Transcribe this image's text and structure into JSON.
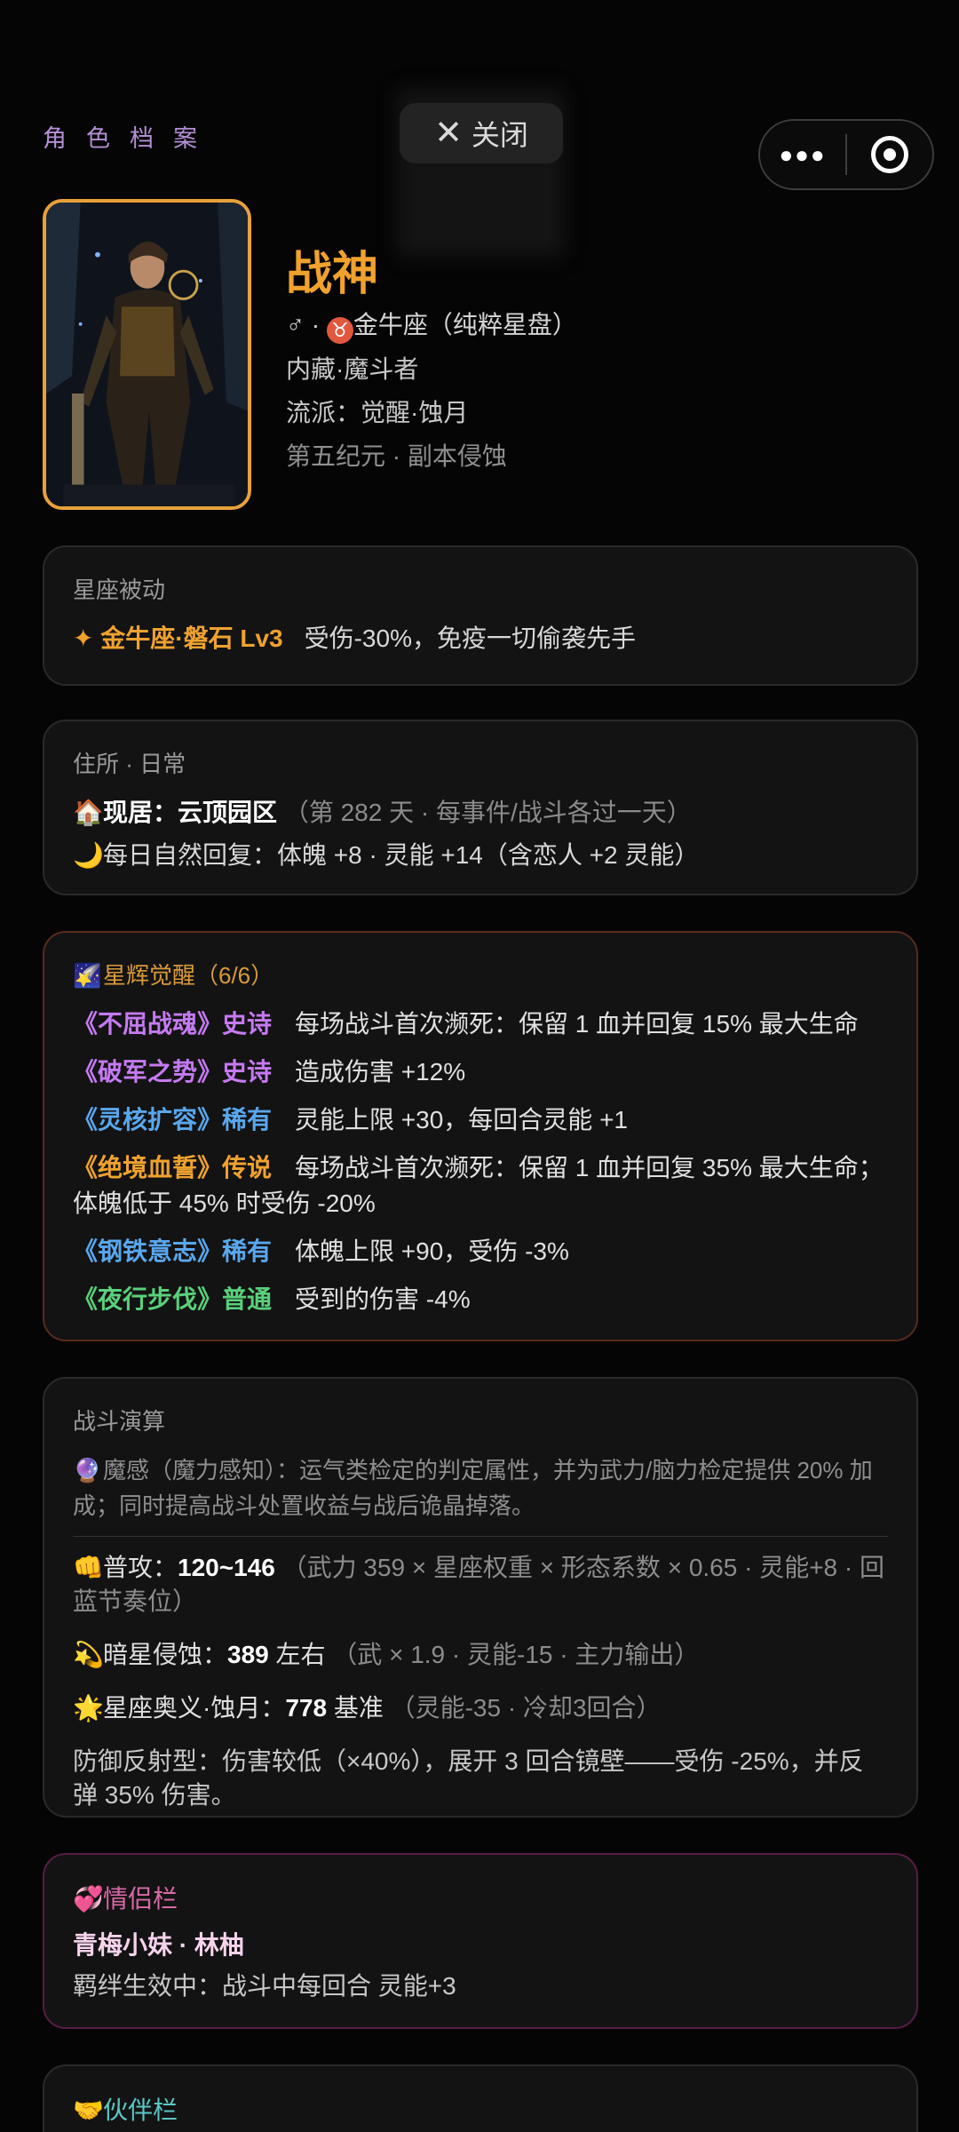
{
  "header": {
    "title": "角色档案",
    "close_label": "关闭"
  },
  "profile": {
    "name": "战神",
    "gender_zodiac": "♂ · ",
    "zodiac_symbol": "♉",
    "zodiac": "金牛座（纯粹星盘）",
    "hidden": "内藏·魔斗者",
    "school": "流派：觉醒·蚀月",
    "era": "第五纪元 · 副本侵蚀"
  },
  "passive": {
    "title": "星座被动",
    "icon": "✦",
    "name": "金牛座·磐石 Lv3",
    "effect": "受伤-30%，免疫一切偷袭先手"
  },
  "residence": {
    "title": "住所 · 日常",
    "home_icon": "🏠",
    "home_label": "现居：",
    "home_name": "云顶园区",
    "home_note": "（第 282 天 · 每事件/战斗各过一天）",
    "moon_icon": "🌙",
    "recovery": "每日自然回复：体魄 +8 · 灵能 +14（含恋人 +2 灵能）"
  },
  "awakening": {
    "icon": "🌠",
    "title": "星辉觉醒（6/6）",
    "items": [
      {
        "name": "《不屈战魂》史诗",
        "desc": "每场战斗首次濒死：保留 1 血并回复 15% 最大生命"
      },
      {
        "name": "《破军之势》史诗",
        "desc": "造成伤害 +12%"
      },
      {
        "name": "《灵核扩容》稀有",
        "desc": "灵能上限 +30，每回合灵能 +1"
      },
      {
        "name": "《绝境血誓》传说",
        "desc": "每场战斗首次濒死：保留 1 血并回复 35% 最大生命；体魄低于 45% 时受伤 -20%"
      },
      {
        "name": "《钢铁意志》稀有",
        "desc": "体魄上限 +90，受伤 -3%"
      },
      {
        "name": "《夜行步伐》普通",
        "desc": "受到的伤害 -4%"
      }
    ]
  },
  "battle": {
    "title": "战斗演算",
    "note_icon": "🔮",
    "note": "魔感（魔力感知）：运气类检定的判定属性，并为武力/脑力检定提供 20% 加成；同时提高战斗处置收益与战后诡晶掉落。",
    "attack_icon": "👊",
    "attack_label": "普攻：",
    "attack_value": "120~146",
    "attack_note": "（武力 359 × 星座权重 × 形态系数 × 0.65 · 灵能+8 · 回蓝节奏位）",
    "erode_icon": "💫",
    "erode_label": "暗星侵蚀：",
    "erode_value": "389",
    "erode_suffix": " 左右",
    "erode_note": "（武 × 1.9 · 灵能-15 · 主力输出）",
    "ult_icon": "🌟",
    "ult_label": "星座奥义·蚀月：",
    "ult_value": "778",
    "ult_suffix": " 基准",
    "ult_note": "（灵能-35 · 冷却3回合）",
    "defense": "防御反射型：伤害较低（×40%），展开 3 回合镜壁——受伤 -25%，并反弹 35% 伤害。"
  },
  "lover": {
    "icon": "💞",
    "title": "情侣栏",
    "name": "青梅小妹 · 林柚",
    "bond": "羁绊生效中：战斗中每回合 灵能+3"
  },
  "partner": {
    "icon": "🤝",
    "title": "伙伴栏"
  },
  "colors": {
    "accent": "#f0a22e",
    "epic": "#c57af2",
    "rare": "#5aa7ee",
    "legend": "#f0a22e",
    "common": "#5ad07a"
  }
}
